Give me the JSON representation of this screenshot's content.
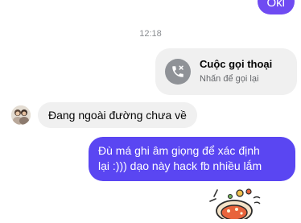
{
  "messages": {
    "prev_outgoing": "Oki",
    "timestamp": "12:18",
    "call": {
      "title": "Cuộc gọi thoại",
      "subtitle": "Nhấn để gọi lại",
      "icon": "missed-call-icon"
    },
    "incoming": "Đang ngoài đường chưa về",
    "outgoing_line1": "Đù má ghi âm giọng để xác định",
    "outgoing_line2": "lại :))) dạo này hack fb nhiều lắm"
  },
  "colors": {
    "outgoing_bubble": "#5a46f2",
    "incoming_bubble": "#f0f0f0"
  }
}
